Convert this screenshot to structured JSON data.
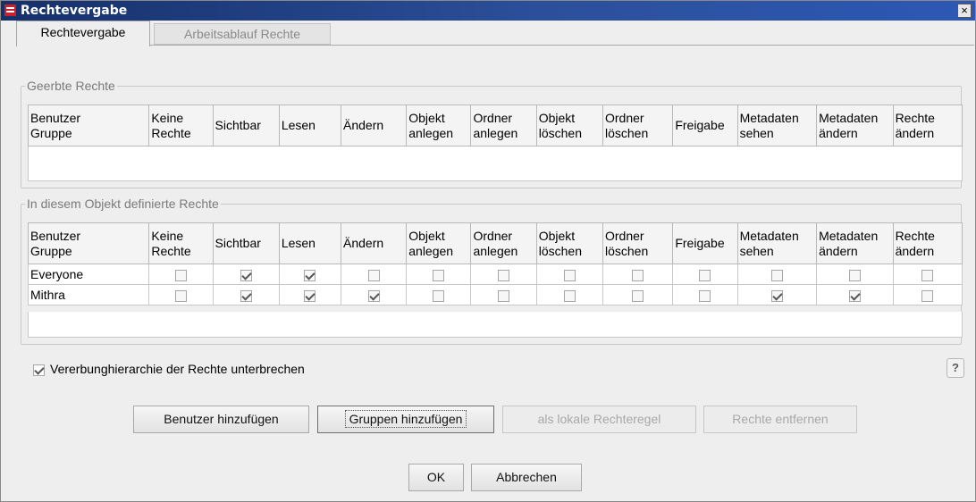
{
  "window": {
    "title": "Rechtevergabe",
    "close_glyph": "×"
  },
  "tabs": [
    {
      "label": "Rechtevergabe",
      "active": true
    },
    {
      "label": "Arbeitsablauf Rechte",
      "active": false
    }
  ],
  "inherited": {
    "legend": "Geerbte Rechte",
    "columns": [
      {
        "l1": "Benutzer",
        "l2": "Gruppe"
      },
      {
        "l1": "Keine",
        "l2": "Rechte"
      },
      {
        "l1": "Sichtbar",
        "l2": ""
      },
      {
        "l1": "Lesen",
        "l2": ""
      },
      {
        "l1": "Ändern",
        "l2": ""
      },
      {
        "l1": "Objekt",
        "l2": "anlegen"
      },
      {
        "l1": "Ordner",
        "l2": "anlegen"
      },
      {
        "l1": "Objekt",
        "l2": "löschen"
      },
      {
        "l1": "Ordner",
        "l2": "löschen"
      },
      {
        "l1": "Freigabe",
        "l2": ""
      },
      {
        "l1": "Metadaten",
        "l2": "sehen"
      },
      {
        "l1": "Metadaten",
        "l2": "ändern"
      },
      {
        "l1": "Rechte",
        "l2": "ändern"
      }
    ],
    "rows": []
  },
  "defined": {
    "legend": "In diesem Objekt definierte Rechte",
    "columns": [
      {
        "l1": "Benutzer",
        "l2": "Gruppe"
      },
      {
        "l1": "Keine",
        "l2": "Rechte"
      },
      {
        "l1": "Sichtbar",
        "l2": ""
      },
      {
        "l1": "Lesen",
        "l2": ""
      },
      {
        "l1": "Ändern",
        "l2": ""
      },
      {
        "l1": "Objekt",
        "l2": "anlegen"
      },
      {
        "l1": "Ordner",
        "l2": "anlegen"
      },
      {
        "l1": "Objekt",
        "l2": "löschen"
      },
      {
        "l1": "Ordner",
        "l2": "löschen"
      },
      {
        "l1": "Freigabe",
        "l2": ""
      },
      {
        "l1": "Metadaten",
        "l2": "sehen"
      },
      {
        "l1": "Metadaten",
        "l2": "ändern"
      },
      {
        "l1": "Rechte",
        "l2": "ändern"
      }
    ],
    "rows": [
      {
        "name": "Everyone",
        "checks": [
          false,
          true,
          true,
          false,
          false,
          false,
          false,
          false,
          false,
          false,
          false,
          false
        ]
      },
      {
        "name": "Mithra",
        "checks": [
          false,
          true,
          true,
          true,
          false,
          false,
          false,
          false,
          false,
          true,
          true,
          false
        ]
      }
    ]
  },
  "inheritance": {
    "label": "Vererbunghierarchie der Rechte unterbrechen",
    "checked": true
  },
  "help": {
    "glyph": "?"
  },
  "actions": {
    "add_user": "Benutzer hinzufügen",
    "add_group": "Gruppen hinzufügen",
    "local_rule": "als lokale Rechteregel",
    "remove_rights": "Rechte entfernen"
  },
  "footer": {
    "ok": "OK",
    "cancel": "Abbrechen"
  }
}
